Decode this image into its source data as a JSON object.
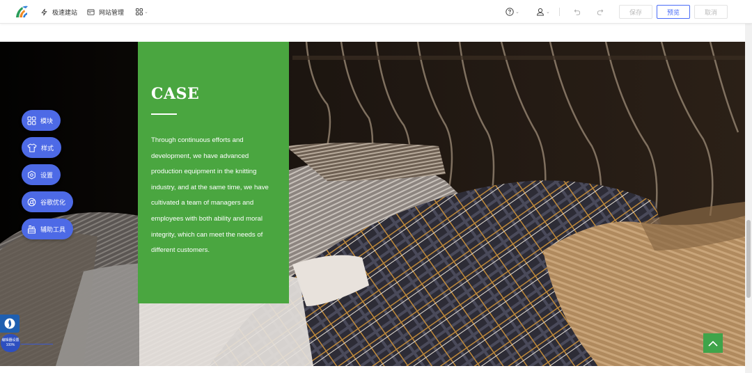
{
  "toolbar": {
    "quick_build": "极速建站",
    "site_manage": "网站管理",
    "save": "保存",
    "preview": "预览",
    "cancel": "取消"
  },
  "icons": {
    "logo": "logo-icon",
    "quick_build": "lightning-icon",
    "site_manage": "window-icon",
    "apps": "grid-icon",
    "help": "help-icon",
    "user": "user-icon",
    "undo": "undo-icon",
    "redo": "redo-icon"
  },
  "case": {
    "title": "CASE",
    "body": "Through continuous efforts and development, we have advanced production equipment in the knitting industry, and at the same time, we have cultivated a team of managers and employees with both ability and moral integrity, which can meet the needs of different customers."
  },
  "tools": [
    {
      "label": "模块",
      "icon": "module-icon"
    },
    {
      "label": "样式",
      "icon": "shirt-icon"
    },
    {
      "label": "设置",
      "icon": "settings-icon"
    },
    {
      "label": "谷歌优化",
      "icon": "google-icon"
    },
    {
      "label": "辅助工具",
      "icon": "toolkit-icon"
    }
  ],
  "zoom": {
    "label": "编辑器设置",
    "value": "100%"
  },
  "colors": {
    "accent": "#4a6cf7",
    "tool_bg": "#4d6ae6",
    "card_green": "#4aa640",
    "backtop_green": "#3fa44a"
  }
}
